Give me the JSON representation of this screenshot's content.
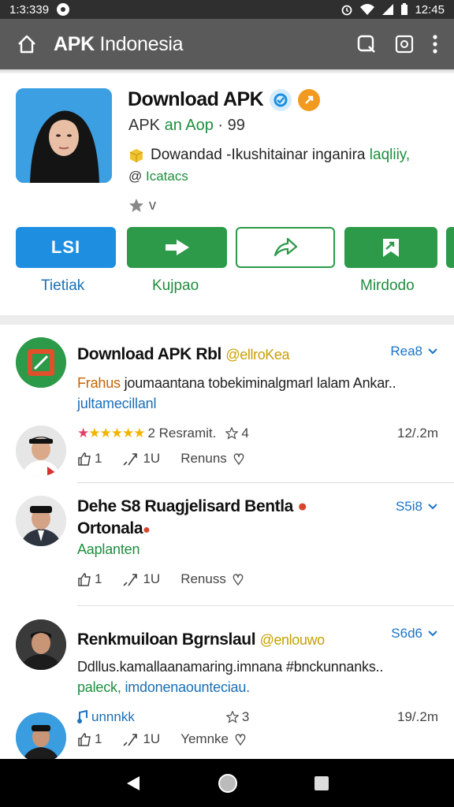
{
  "status_bar": {
    "time_left": "1:3:339",
    "time_right": "12:45"
  },
  "app_bar": {
    "title_bold": "APK",
    "title_rest": " Indonesia"
  },
  "hero": {
    "title": "Download APK",
    "subtitle_a": "APK ",
    "subtitle_b": "an Aop",
    "subtitle_c": " · 99",
    "desc_a": "Dowandad -Ikushitainar inganira ",
    "desc_b": "laqliiy,",
    "tag_at": "@",
    "tag": " Icatacs",
    "rating": "v"
  },
  "buttons": [
    {
      "label": "LSI",
      "caption": "Tietiak"
    },
    {
      "caption": "Kujpao"
    },
    {
      "caption": ""
    },
    {
      "caption": "Mirdodo"
    }
  ],
  "posts": [
    {
      "title": "Download APK Rbl",
      "handle": "@ellroKea",
      "count": "Rea8",
      "body_1_orange": "Frahus",
      "body_1": " joumaantana tobekiminalgmarl lalam Ankar..",
      "body_2": "jultamecillanl",
      "rating_text": "2 Resramit.",
      "rating_votes": "4",
      "time": "12/.2m",
      "likes": "1",
      "comments": "1U",
      "action": "Renuns"
    },
    {
      "title": "Dehe S8 Ruagjelisard Bentla",
      "title_2": "Ortonala",
      "count": "S5i8",
      "body_1": "Aaplanten",
      "likes": "1",
      "comments": "1U",
      "action": "Renuss"
    },
    {
      "title": "Renkmuiloan Bgrnslaul",
      "handle": "@enlouwo",
      "count": "S6d6",
      "body_1": "Ddllus.kamallaanamaring.imnana #bnckunnanks..",
      "body_2_green": "paleck,",
      "body_2": " imdonenaounteciau.",
      "tag": "unnnkk",
      "votes": "3",
      "time": "19/.2m",
      "likes": "1",
      "comments": "1U",
      "action": "Yemnke"
    }
  ],
  "colors": {
    "accent_blue": "#1e8fe0",
    "accent_green": "#2c9a49",
    "app_bar": "#5a5a5a"
  }
}
